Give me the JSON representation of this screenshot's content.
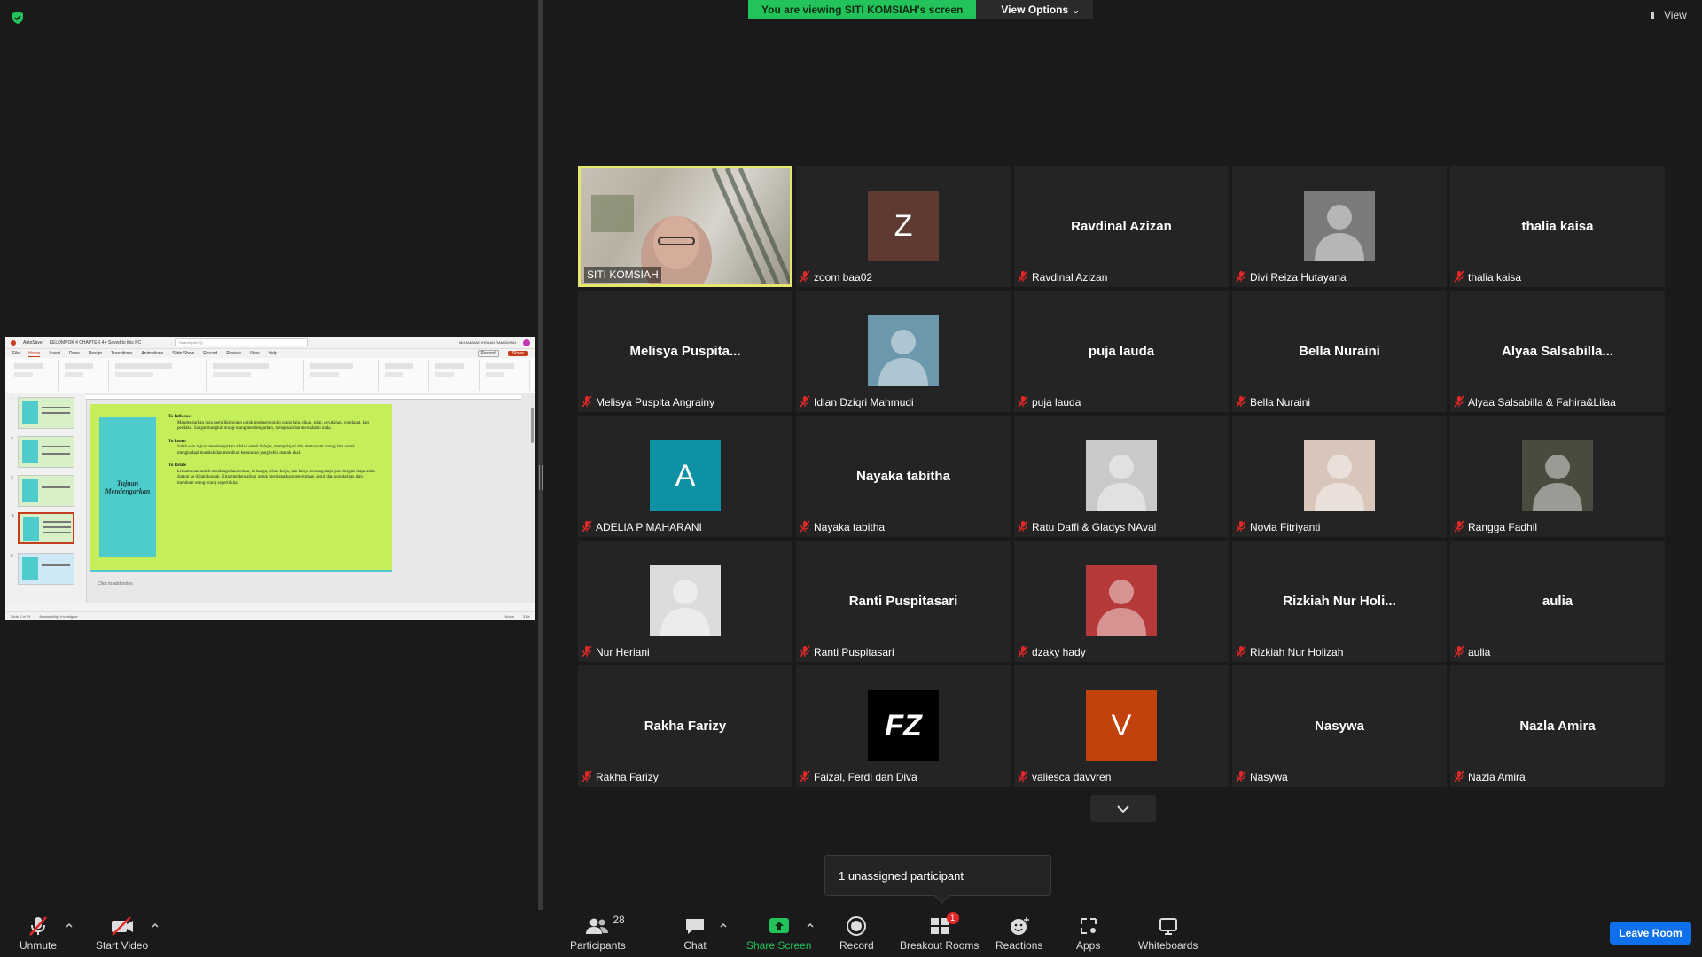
{
  "banner": {
    "viewing_text": "You are viewing SITI KOMSIAH's screen",
    "view_options": "View Options"
  },
  "view_button": "View",
  "presentation": {
    "file_title": "KELOMPOK 4 CHAPTER 4 • Saved to this PC",
    "autosave": "AutoSave",
    "search_placeholder": "Search (Alt+Q)",
    "user": "MUHAMMAD IHSAAN RAMADHAN",
    "tabs": [
      "File",
      "Home",
      "Insert",
      "Draw",
      "Design",
      "Transitions",
      "Animations",
      "Slide Show",
      "Record",
      "Review",
      "View",
      "Help"
    ],
    "record_btn": "Record",
    "share_btn": "Share",
    "slide_title": "Tujuan Mendengarkan",
    "points": [
      {
        "heading": "To Influence",
        "body": "Mendengarkan juga memiliki tujuan untuk mempengaruhi orang lain, sikap, nilai, keyakinan, pendapat, dan perilaku. Sangat mungkin orang-orang mendengarkan, mengenal dan memahami anda."
      },
      {
        "heading": "To Learn",
        "body": "Salah satu tujuan mendengarkan adalah untuk belajar, mempelajari dan memahami orang lain untuk menghadapi masalah dan membuat keputusan yang lebih masuk akal."
      },
      {
        "heading": "To Relate",
        "body": "kemampuan untuk mendengarkan teman, keluarga, rekan kerja, dan hanya tentang siapa pun dengan siapa anda datang ke dalam kontak. Kita mendengarkan untuk mendapatkan penerimaan sosial dan popularitas, dan membuat orang-orang seperti kita"
      }
    ],
    "notes": "Click to add notes",
    "status_left": "Slide 4 of 29",
    "accessibility": "Accessibility: Investigate",
    "notes_btn": "Notes",
    "zoom": "31%"
  },
  "participants": [
    {
      "label": "SITI KOMSIAH",
      "type": "video",
      "active": true
    },
    {
      "label": "zoom baa02",
      "type": "letter",
      "letter": "Z",
      "color": "#5e3a32"
    },
    {
      "label": "Ravdinal Azizan",
      "type": "name",
      "display": "Ravdinal Azizan"
    },
    {
      "label": "Divi Reiza Hutayana",
      "type": "photo",
      "color": "#7a7a78"
    },
    {
      "label": "thalia kaisa",
      "type": "name",
      "display": "thalia kaisa"
    },
    {
      "label": "Melisya Puspita Angrainy",
      "type": "name",
      "display": "Melisya Puspita..."
    },
    {
      "label": "Idlan Dziqri Mahmudi",
      "type": "photo",
      "color": "#6c98ad"
    },
    {
      "label": "puja lauda",
      "type": "name",
      "display": "puja lauda"
    },
    {
      "label": "Bella Nuraini",
      "type": "name",
      "display": "Bella Nuraini"
    },
    {
      "label": "Alyaa Salsabilla & Fahira&Lilaa",
      "type": "name",
      "display": "Alyaa Salsabilla..."
    },
    {
      "label": "ADELIA P MAHARANI",
      "type": "letter",
      "letter": "A",
      "color": "#0e91a4"
    },
    {
      "label": "Nayaka tabitha",
      "type": "name",
      "display": "Nayaka tabitha"
    },
    {
      "label": "Ratu Daffi & Gladys NAval",
      "type": "photo",
      "color": "#c9c9c9"
    },
    {
      "label": "Novia Fitriyanti",
      "type": "photo",
      "color": "#d9c6bb"
    },
    {
      "label": "Rangga Fadhil",
      "type": "photo",
      "color": "#4a4a3e"
    },
    {
      "label": "Nur Heriani",
      "type": "photo",
      "color": "#dcdcdc"
    },
    {
      "label": "Ranti Puspitasari",
      "type": "name",
      "display": "Ranti Puspitasari"
    },
    {
      "label": "dzaky hady",
      "type": "photo",
      "color": "#b73a3a"
    },
    {
      "label": "Rizkiah Nur Holizah",
      "type": "name",
      "display": "Rizkiah Nur Holi..."
    },
    {
      "label": "aulia",
      "type": "name",
      "display": "aulia"
    },
    {
      "label": "Rakha Farizy",
      "type": "name",
      "display": "Rakha Farizy"
    },
    {
      "label": "Faizal, Ferdi dan Diva",
      "type": "logo",
      "letter": "FZ",
      "color": "#000000"
    },
    {
      "label": "valiesca davvren",
      "type": "letter",
      "letter": "V",
      "color": "#c2410c"
    },
    {
      "label": "Nasywa",
      "type": "name",
      "display": "Nasywa"
    },
    {
      "label": "Nazla Amira",
      "type": "name",
      "display": "Nazla Amira"
    }
  ],
  "tooltip": "1 unassigned participant",
  "toolbar": {
    "unmute": "Unmute",
    "start_video": "Start Video",
    "participants": "Participants",
    "participants_count": "28",
    "chat": "Chat",
    "share_screen": "Share Screen",
    "record": "Record",
    "breakout": "Breakout Rooms",
    "breakout_badge": "1",
    "reactions": "Reactions",
    "apps": "Apps",
    "whiteboards": "Whiteboards",
    "leave": "Leave Room"
  },
  "colors": {
    "accent_green": "#22c35a",
    "active_border": "#e6e66c",
    "leave_blue": "#0e71eb",
    "tile_bg": "#242424"
  }
}
